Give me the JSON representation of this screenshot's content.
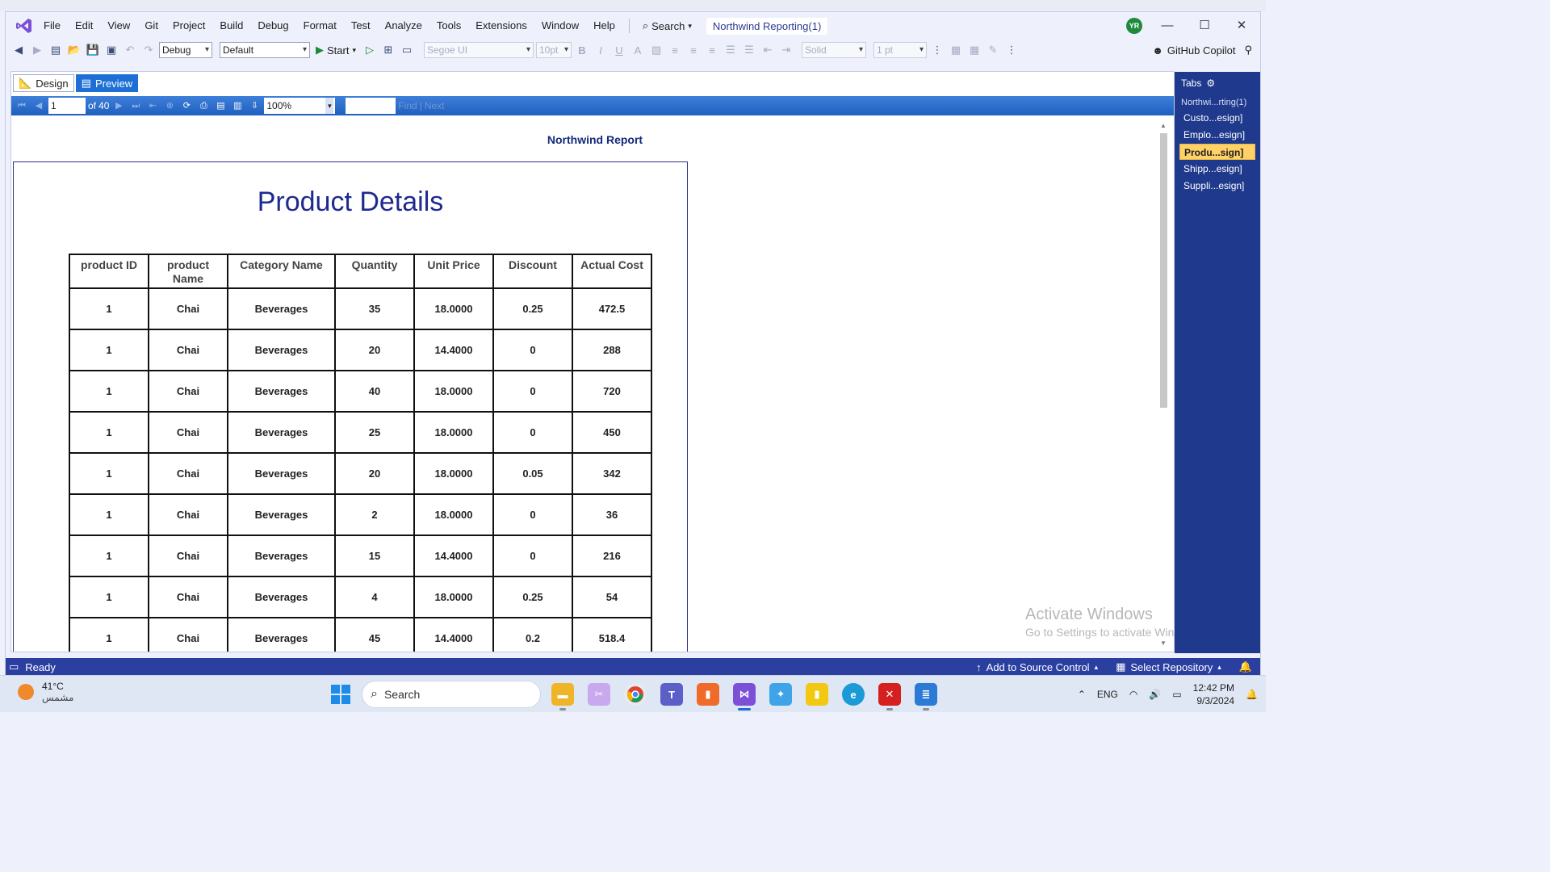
{
  "menu": {
    "items": [
      "File",
      "Edit",
      "View",
      "Git",
      "Project",
      "Build",
      "Debug",
      "Format",
      "Test",
      "Analyze",
      "Tools",
      "Extensions",
      "Window",
      "Help"
    ],
    "search_label": "Search",
    "solution_name": "Northwind Reporting(1)",
    "avatar_initials": "YR"
  },
  "toolbar": {
    "config": "Debug",
    "platform": "Default",
    "start_label": "Start",
    "font_name": "Segoe UI",
    "font_size": "10pt",
    "border_style": "Solid",
    "border_width": "1 pt",
    "copilot_label": "GitHub Copilot"
  },
  "doc_tabs": {
    "design": "Design",
    "preview": "Preview"
  },
  "viewer": {
    "page_current": "1",
    "page_of": "of",
    "page_total": "40",
    "zoom": "100%",
    "find_label": "Find",
    "next_label": "Next"
  },
  "report": {
    "header": "Northwind Report",
    "title": "Product Details",
    "columns": [
      {
        "line1": "product ID",
        "line2": ""
      },
      {
        "line1": "product",
        "line2": "Name"
      },
      {
        "line1": "Category Name",
        "line2": ""
      },
      {
        "line1": "Quantity",
        "line2": ""
      },
      {
        "line1": "Unit Price",
        "line2": ""
      },
      {
        "line1": "Discount",
        "line2": ""
      },
      {
        "line1": "Actual Cost",
        "line2": ""
      }
    ],
    "rows": [
      [
        "1",
        "Chai",
        "Beverages",
        "35",
        "18.0000",
        "0.25",
        "472.5"
      ],
      [
        "1",
        "Chai",
        "Beverages",
        "20",
        "14.4000",
        "0",
        "288"
      ],
      [
        "1",
        "Chai",
        "Beverages",
        "40",
        "18.0000",
        "0",
        "720"
      ],
      [
        "1",
        "Chai",
        "Beverages",
        "25",
        "18.0000",
        "0",
        "450"
      ],
      [
        "1",
        "Chai",
        "Beverages",
        "20",
        "18.0000",
        "0.05",
        "342"
      ],
      [
        "1",
        "Chai",
        "Beverages",
        "2",
        "18.0000",
        "0",
        "36"
      ],
      [
        "1",
        "Chai",
        "Beverages",
        "15",
        "14.4000",
        "0",
        "216"
      ],
      [
        "1",
        "Chai",
        "Beverages",
        "4",
        "18.0000",
        "0.25",
        "54"
      ],
      [
        "1",
        "Chai",
        "Beverages",
        "45",
        "14.4000",
        "0.2",
        "518.4"
      ]
    ]
  },
  "watermark": {
    "line1": "Activate Windows",
    "line2": "Go to Settings to activate Windows."
  },
  "tabs_panel": {
    "title": "Tabs",
    "header_item": "Northwi...rting(1)",
    "items": [
      "Custo...esign]",
      "Emplo...esign]",
      "Produ...sign]",
      "Shipp...esign]",
      "Suppli...esign]"
    ],
    "active_index": 2
  },
  "status": {
    "ready": "Ready",
    "add_source": "Add to Source Control",
    "select_repo": "Select Repository"
  },
  "taskbar": {
    "weather_temp": "41°C",
    "weather_desc": "مشمس",
    "search_label": "Search",
    "language": "ENG",
    "time": "12:42 PM",
    "date": "9/3/2024"
  },
  "colors": {
    "accent": "#1d6fd6",
    "report_title": "#1f2a8f",
    "tabs_panel_bg": "#1f3a8c",
    "status_bar": "#2b3fa0",
    "active_tab_highlight": "#ffd166"
  }
}
